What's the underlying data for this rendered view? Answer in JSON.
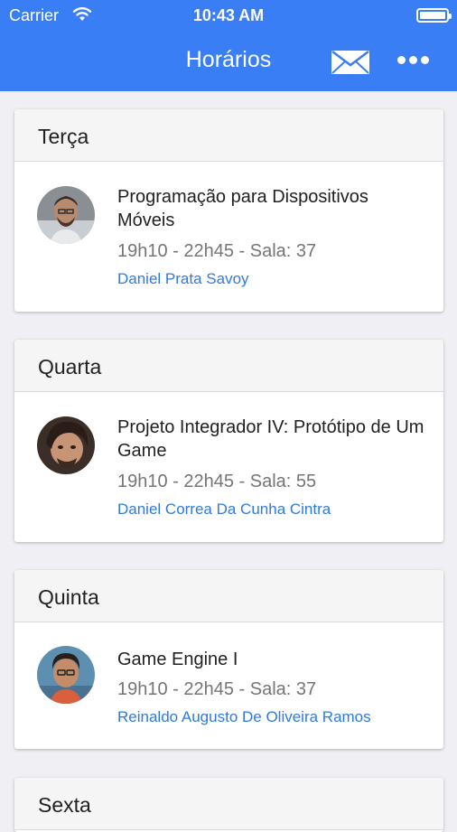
{
  "status_bar": {
    "carrier": "Carrier",
    "time": "10:43 AM"
  },
  "nav": {
    "title": "Horários",
    "mail_icon": "mail-icon",
    "more_icon": "more-horizontal-icon"
  },
  "colors": {
    "header": "#3a7ef5",
    "link": "#2f7ae0"
  },
  "days": [
    {
      "day": "Terça",
      "course": "Programação para Dispositivos Móveis",
      "schedule": "19h10 - 22h45 - Sala: 37",
      "teacher": "Daniel Prata Savoy"
    },
    {
      "day": "Quarta",
      "course": "Projeto Integrador IV: Protótipo de Um Game",
      "schedule": "19h10 - 22h45 - Sala: 55",
      "teacher": "Daniel Correa Da Cunha Cintra"
    },
    {
      "day": "Quinta",
      "course": "Game Engine I",
      "schedule": "19h10 - 22h45 - Sala: 37",
      "teacher": "Reinaldo Augusto De Oliveira Ramos"
    },
    {
      "day": "Sexta"
    }
  ]
}
